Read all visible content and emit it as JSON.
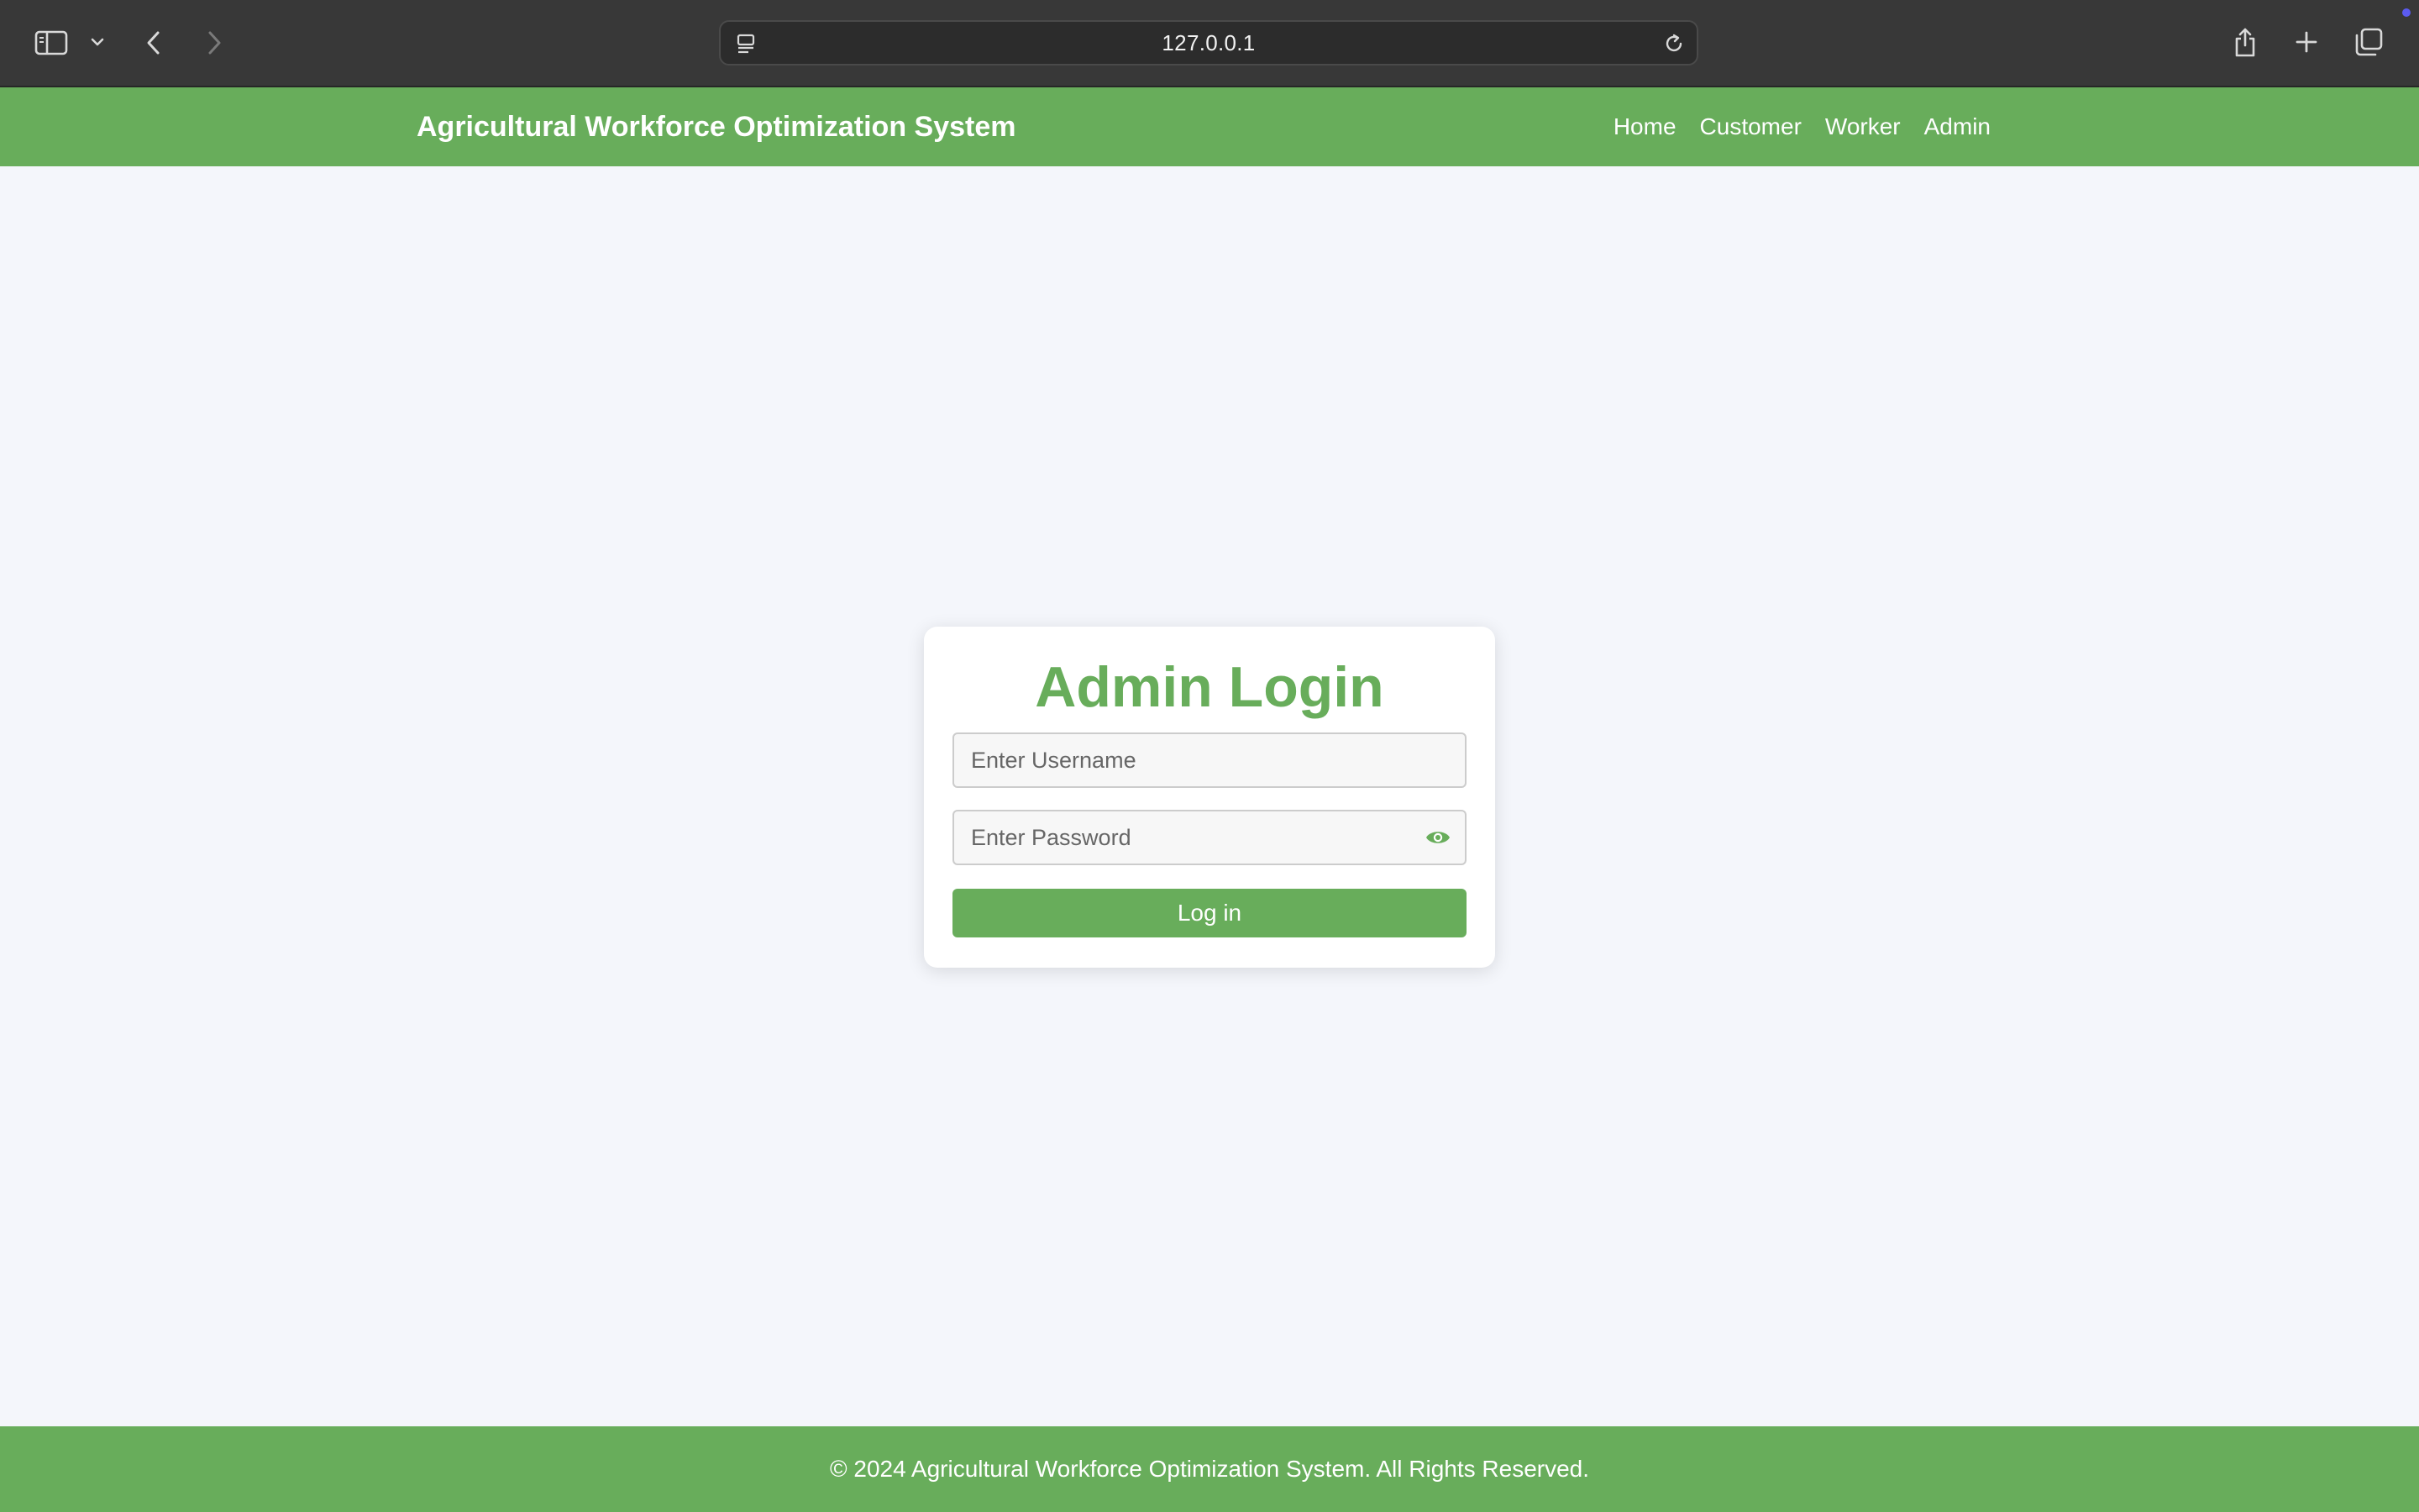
{
  "browser": {
    "url": "127.0.0.1",
    "icons": {
      "sidebar": "sidebar-toggle-icon",
      "dropdown": "chevron-down-icon",
      "back": "back-arrow-icon",
      "forward": "forward-arrow-icon",
      "page_menu": "page-menu-icon",
      "reload": "reload-icon",
      "share": "share-icon",
      "new_tab": "plus-icon",
      "tabs": "tab-overview-icon"
    },
    "notification_color": "#5b5bf0"
  },
  "site": {
    "brand": "Agricultural Workforce Optimization System",
    "nav": [
      {
        "label": "Home"
      },
      {
        "label": "Customer"
      },
      {
        "label": "Worker"
      },
      {
        "label": "Admin"
      }
    ]
  },
  "login": {
    "title": "Admin Login",
    "username_placeholder": "Enter Username",
    "username_value": "",
    "password_placeholder": "Enter Password",
    "password_value": "",
    "password_toggle_icon": "eye-icon",
    "submit_label": "Log in"
  },
  "footer": {
    "text": "© 2024 Agricultural Workforce Optimization System. All Rights Reserved."
  },
  "colors": {
    "brand_green": "#68ad5b",
    "page_background": "#f4f6fb",
    "browser_chrome": "#383838"
  }
}
